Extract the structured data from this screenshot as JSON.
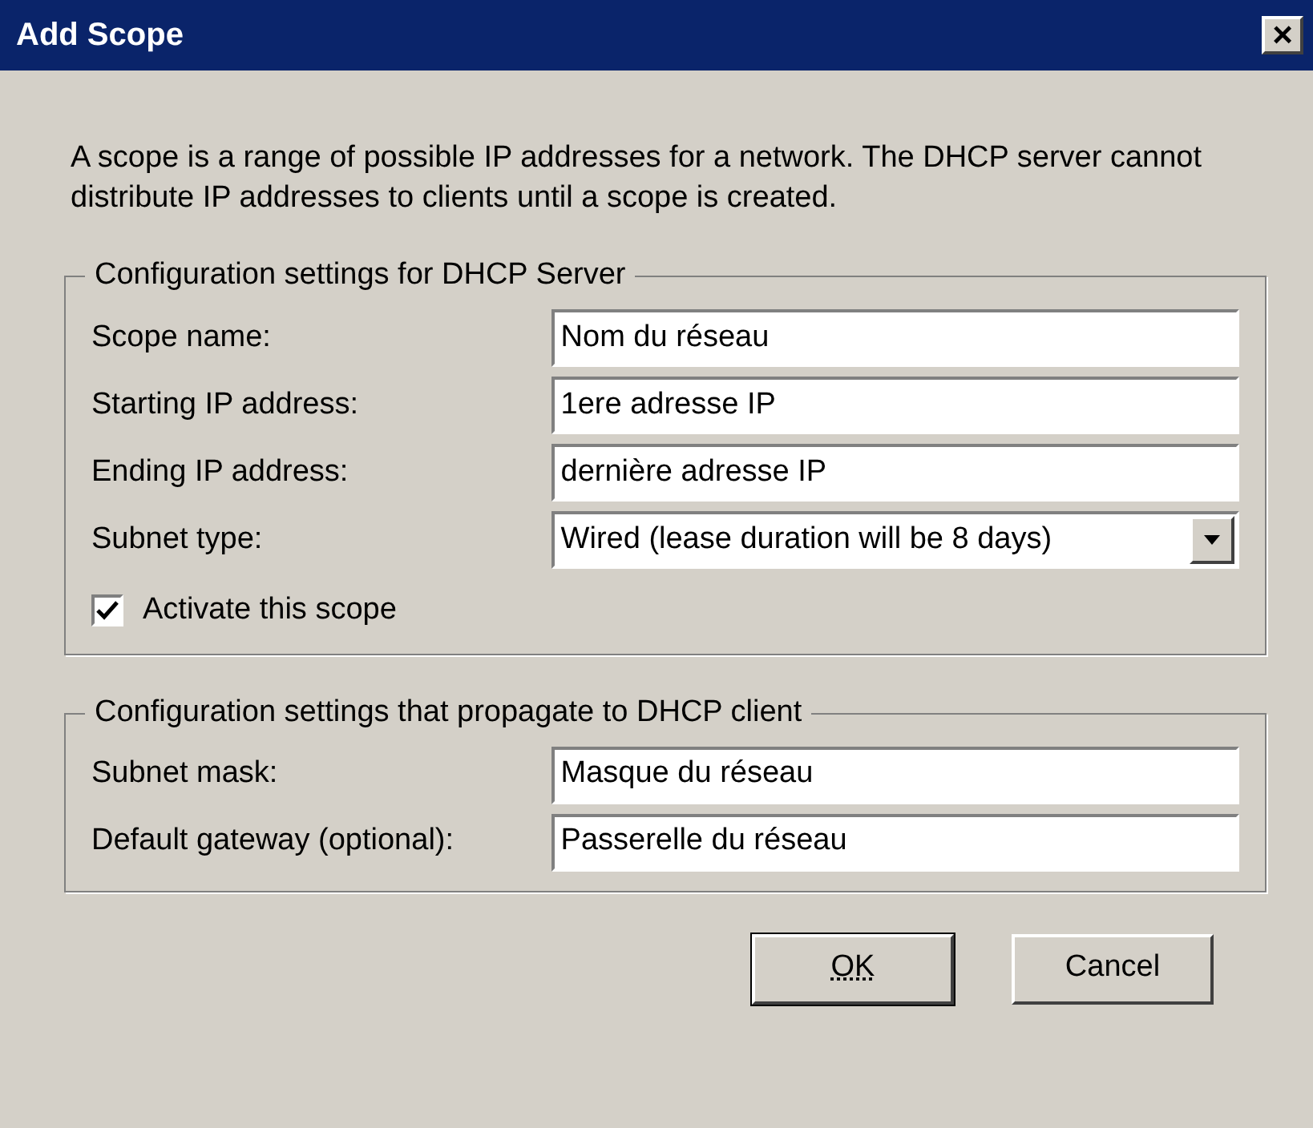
{
  "window": {
    "title": "Add Scope",
    "close": "×"
  },
  "description": "A scope is a range of possible IP addresses for a network. The DHCP server cannot distribute IP addresses to clients until a scope is created.",
  "groups": [
    {
      "title": "Configuration settings for DHCP Server",
      "fields": [
        {
          "kind": "text",
          "label": "Scope name:",
          "value": "Nom du réseau"
        },
        {
          "kind": "text",
          "label": "Starting IP address:",
          "value": "1ere adresse IP"
        },
        {
          "kind": "text",
          "label": "Ending IP address:",
          "value": "dernière adresse IP"
        },
        {
          "kind": "select",
          "label": "Subnet type:",
          "value": "Wired (lease duration will be 8 days)"
        }
      ],
      "checkbox": {
        "label": "Activate this scope",
        "checked": true
      }
    },
    {
      "title": "Configuration settings that propagate to DHCP client",
      "fields": [
        {
          "kind": "text",
          "label": "Subnet mask:",
          "value": "Masque du réseau"
        },
        {
          "kind": "text",
          "label": "Default gateway (optional):",
          "value": "Passerelle du réseau"
        }
      ]
    }
  ],
  "buttons": [
    {
      "label": "OK",
      "default": true
    },
    {
      "label": "Cancel",
      "default": false
    }
  ]
}
